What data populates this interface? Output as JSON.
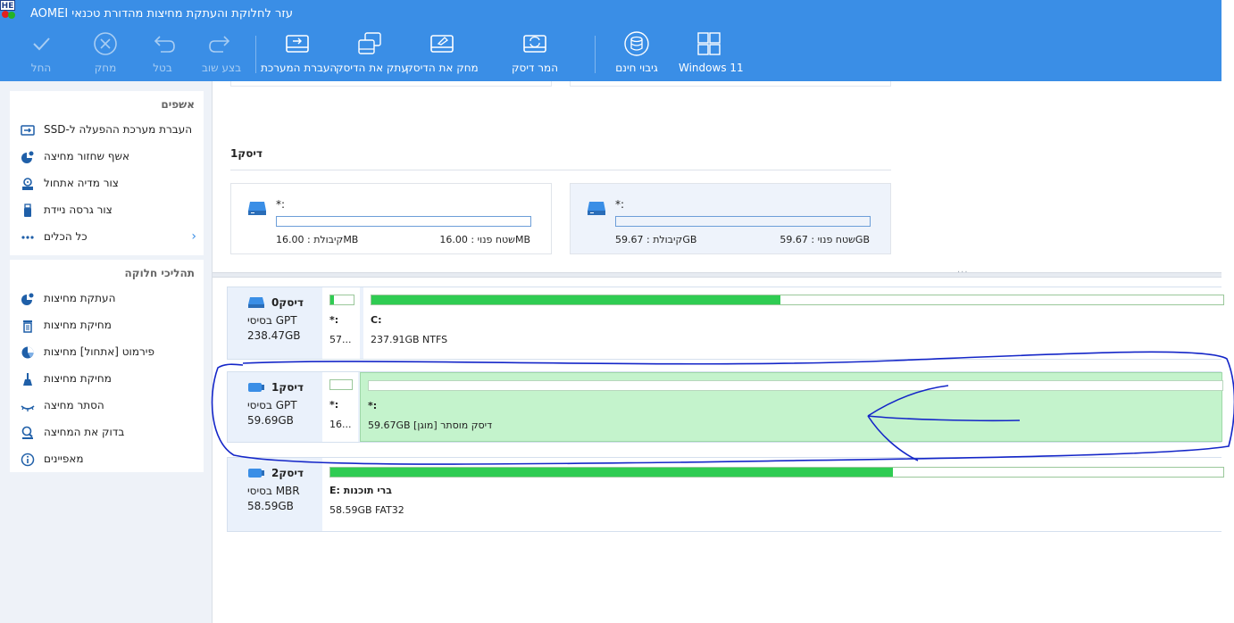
{
  "window": {
    "language_badge": "HE",
    "title": "עזר לחלוקת והעתקת מחיצות מהדורת טכנאי AOMEI"
  },
  "toolbar": {
    "apply": "החל",
    "discard": "מחק",
    "undo": "בטל",
    "redo": "בצע שוב",
    "migrate_os": "העברת המערכת",
    "clone_disk": "עתק את הדיסק",
    "wipe_disk": "מחק את הדיסק",
    "convert_disk": "המר דיסק",
    "free_backup": "גיבוי חינם",
    "windows11": "Windows 11"
  },
  "sidebar": {
    "wizards": {
      "title": "אשפים",
      "items": [
        {
          "label": "העברת מערכת ההפעלה ל-SSD",
          "icon": "migrate-icon"
        },
        {
          "label": "אשף שחזור מחיצה",
          "icon": "recovery-icon"
        },
        {
          "label": "צור מדיה אתחול",
          "icon": "bootable-media-icon"
        },
        {
          "label": "צור גרסה ניידת",
          "icon": "portable-icon"
        },
        {
          "label": "כל הכלים",
          "icon": "all-tools-icon"
        }
      ]
    },
    "operations": {
      "title": "תהליכי חלוקה",
      "items": [
        {
          "label": "העתקת מחיצות",
          "icon": "copy-partition-icon"
        },
        {
          "label": "מחיקת מחיצות",
          "icon": "delete-partition-icon"
        },
        {
          "label": "פירמוט [אתחול] מחיצות",
          "icon": "format-partition-icon"
        },
        {
          "label": "מחיקת מחיצות",
          "icon": "wipe-partition-icon"
        },
        {
          "label": "הסתר מחיצה",
          "icon": "hide-partition-icon"
        },
        {
          "label": "בדוק את המחיצה",
          "icon": "check-partition-icon"
        },
        {
          "label": "מאפיינים",
          "icon": "info-icon"
        }
      ]
    }
  },
  "upper_view": {
    "disk_heading": "דיסק1",
    "cards": [
      {
        "name": "*:",
        "free": "16.00 : שטח פנויMB",
        "capacity": "16.00 : קיבולתMB"
      },
      {
        "name": "*:",
        "free": "59.67 : שטח פנויGB",
        "capacity": "59.67 : קיבולתGB"
      }
    ]
  },
  "disks": [
    {
      "name": "דיסק0",
      "type": "בסיסי GPT",
      "size": "238.47GB",
      "partitions": [
        {
          "name": "*:",
          "desc": "57...",
          "used_fraction": 0.15
        },
        {
          "name": "C:",
          "desc": "237.91GB NTFS",
          "used_fraction": 0.48
        }
      ]
    },
    {
      "name": "דיסק1",
      "type": "בסיסי GPT",
      "size": "59.69GB",
      "partitions": [
        {
          "name": "*:",
          "desc": "16...",
          "used_fraction": 0.0
        },
        {
          "name": "*:",
          "desc": "59.67GB [מוגן] דיסק מוסתר",
          "used_fraction": 0.0
        }
      ]
    },
    {
      "name": "דיסק2",
      "type": "בסיסי MBR",
      "size": "58.59GB",
      "partitions": [
        {
          "name": "E: ברי תוכנות",
          "desc": "58.59GB FAT32",
          "used_fraction": 0.63
        }
      ]
    }
  ],
  "colors": {
    "accent": "#3a8ee6",
    "used_bar": "#2fcc52",
    "selected_partition": "#c4f3cc",
    "annotation_ink": "#1426c8"
  }
}
